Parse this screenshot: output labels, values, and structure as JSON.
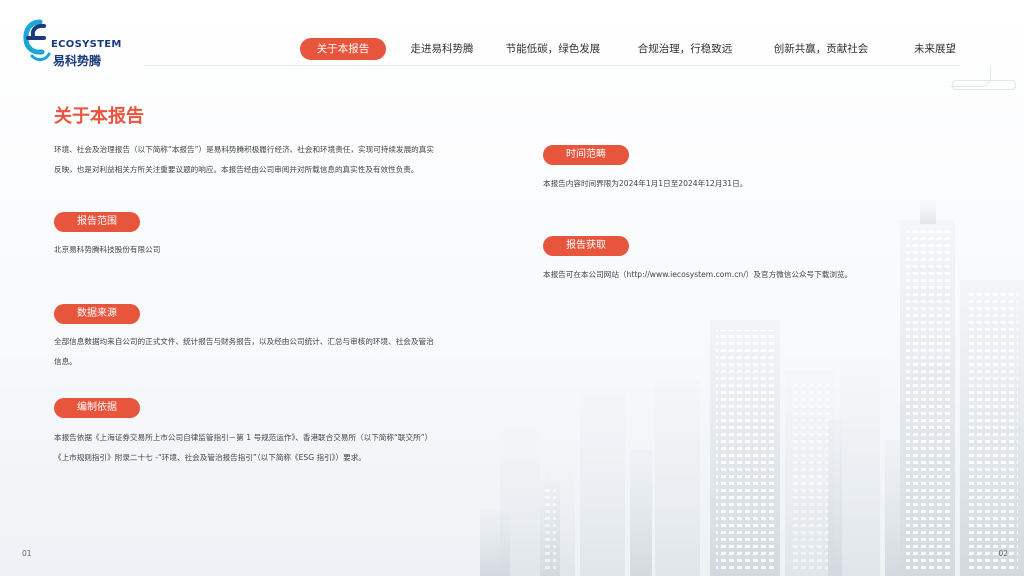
{
  "logo": {
    "en": "ECOSYSTEM",
    "cn": "易科势腾"
  },
  "nav": {
    "items": [
      {
        "label": "关于本报告",
        "active": true
      },
      {
        "label": "走进易科势腾",
        "active": false
      },
      {
        "label": "节能低碳，绿色发展",
        "active": false
      },
      {
        "label": "合规治理，行稳致远",
        "active": false
      },
      {
        "label": "创新共赢，贡献社会",
        "active": false
      },
      {
        "label": "未来展望",
        "active": false
      }
    ]
  },
  "title": "关于本报告",
  "intro": {
    "line1": "环境、社会及治理报告（以下简称“本报告”）是易科势腾积极履行经济、社会和环境责任，实现可持续发展的真实",
    "line2": "反映，也是对利益相关方所关注重要议题的响应。本报告经由公司审阅并对所载信息的真实性及有效性负责。"
  },
  "scope": {
    "label": "报告范围",
    "text": "北京易科势腾科技股份有限公司"
  },
  "source": {
    "label": "数据来源",
    "line1": "全部信息数据均来自公司的正式文件、统计报告与财务报告，以及经由公司统计、汇总与审核的环境、社会及管治",
    "line2": "信息。"
  },
  "basis": {
    "label": "编制依据",
    "line1": "本报告依据《上海证券交易所上市公司自律监管指引－第 1 号规范运作》、香港联合交易所（以下简称“联交所”）",
    "line2": "《上市规则指引》附录二十七 -“环境、社会及管治报告指引”（以下简称《ESG 指引》）要求。"
  },
  "period": {
    "label": "时间范畴",
    "text": "本报告内容时间界限为2024年1月1日至2024年12月31日。"
  },
  "access": {
    "label": "报告获取",
    "text": "本报告可在本公司网站（http://www.iecosystem.com.cn/）及官方微信公众号下载浏览。"
  },
  "pages": {
    "left": "01",
    "right": "02"
  },
  "colors": {
    "accent": "#e8553d",
    "logo_blue": "#1a3a7c",
    "logo_cyan": "#1aa7d8"
  }
}
